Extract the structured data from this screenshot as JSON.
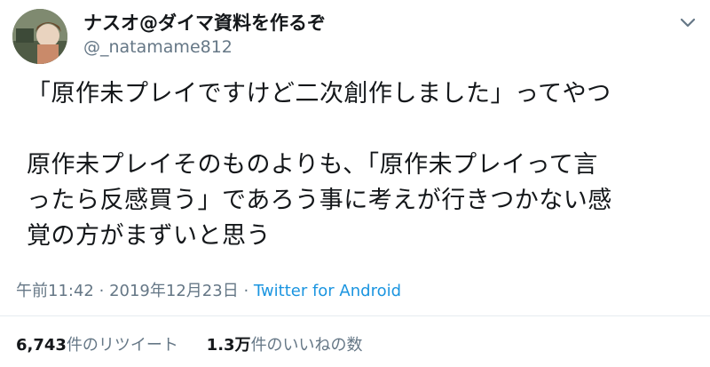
{
  "tweet": {
    "display_name": "ナスオ@ダイマ資料を作るぞ",
    "handle": "@_natamame812",
    "body_paragraph_1": "「原作未プレイですけど二次創作しました」ってやつ",
    "body_paragraph_2": "原作未プレイそのものよりも、「原作未プレイって言\nったら反感買う」であろう事に考えが行きつかない感\n覚の方がまずいと思う",
    "time": "午前11:42",
    "separator": "·",
    "date": "2019年12月23日",
    "source": "Twitter for Android",
    "retweet_count": "6,743",
    "retweet_label": "件のリツイート",
    "like_count": "1.3万",
    "like_label": "件のいいねの数"
  },
  "icons": {
    "caret": "chevron-down-icon",
    "avatar": "avatar-image"
  }
}
